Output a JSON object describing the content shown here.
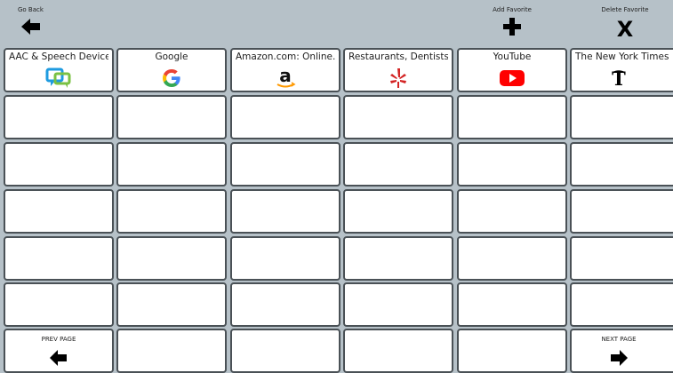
{
  "toolbar": {
    "go_back_label": "Go Back",
    "add_favorite_label": "Add Favorite",
    "delete_favorite_label": "Delete Favorite",
    "delete_glyph": "X"
  },
  "favorites": [
    {
      "title": "AAC & Speech Device...",
      "icon": "aac-chat-icon",
      "color": "#1e9be0"
    },
    {
      "title": "Google",
      "icon": "google-icon",
      "color": "#4285f4"
    },
    {
      "title": "Amazon.com: Online...",
      "icon": "amazon-icon",
      "color": "#ff9900"
    },
    {
      "title": "Restaurants, Dentists,...",
      "icon": "yelp-icon",
      "color": "#d32323"
    },
    {
      "title": "YouTube",
      "icon": "youtube-icon",
      "color": "#ff0000"
    },
    {
      "title": "The New York Times -...",
      "icon": "nyt-icon",
      "color": "#000000"
    }
  ],
  "pager": {
    "prev_label": "PREV PAGE",
    "next_label": "NEXT PAGE"
  }
}
